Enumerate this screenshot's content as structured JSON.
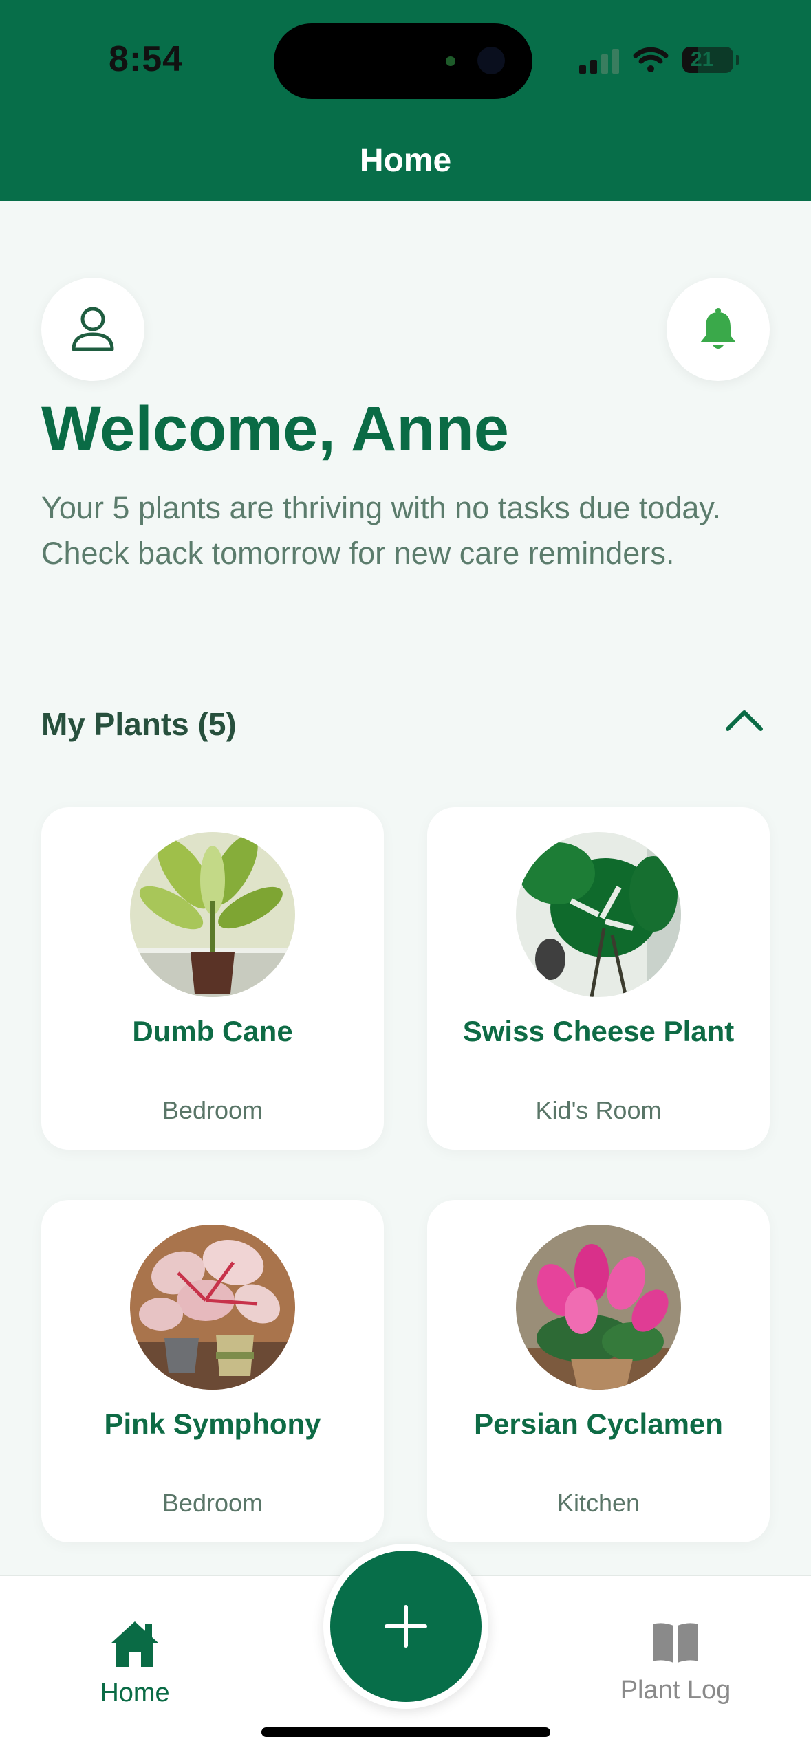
{
  "status_bar": {
    "time": "8:54",
    "battery": "21"
  },
  "header": {
    "title": "Home"
  },
  "welcome": {
    "heading": "Welcome, Anne",
    "message": "Your 5 plants are thriving with no tasks due today. Check back tomorrow for new care reminders."
  },
  "plants_section": {
    "title": "My Plants (5)"
  },
  "plants": [
    {
      "name": "Dumb Cane",
      "room": "Bedroom"
    },
    {
      "name": "Swiss Cheese Plant",
      "room": "Kid's Room"
    },
    {
      "name": "Pink Symphony",
      "room": "Bedroom"
    },
    {
      "name": "Persian Cyclamen",
      "room": "Kitchen"
    }
  ],
  "tabbar": {
    "home_label": "Home",
    "log_label": "Plant Log"
  },
  "colors": {
    "primary": "#076e49",
    "accent_bell": "#3aa94a",
    "background": "#f3f8f6"
  },
  "icons": {
    "profile": "person-outline-icon",
    "notifications": "bell-icon",
    "collapse": "chevron-up-icon",
    "add": "plus-icon",
    "home": "house-icon",
    "plant_log": "book-icon"
  }
}
